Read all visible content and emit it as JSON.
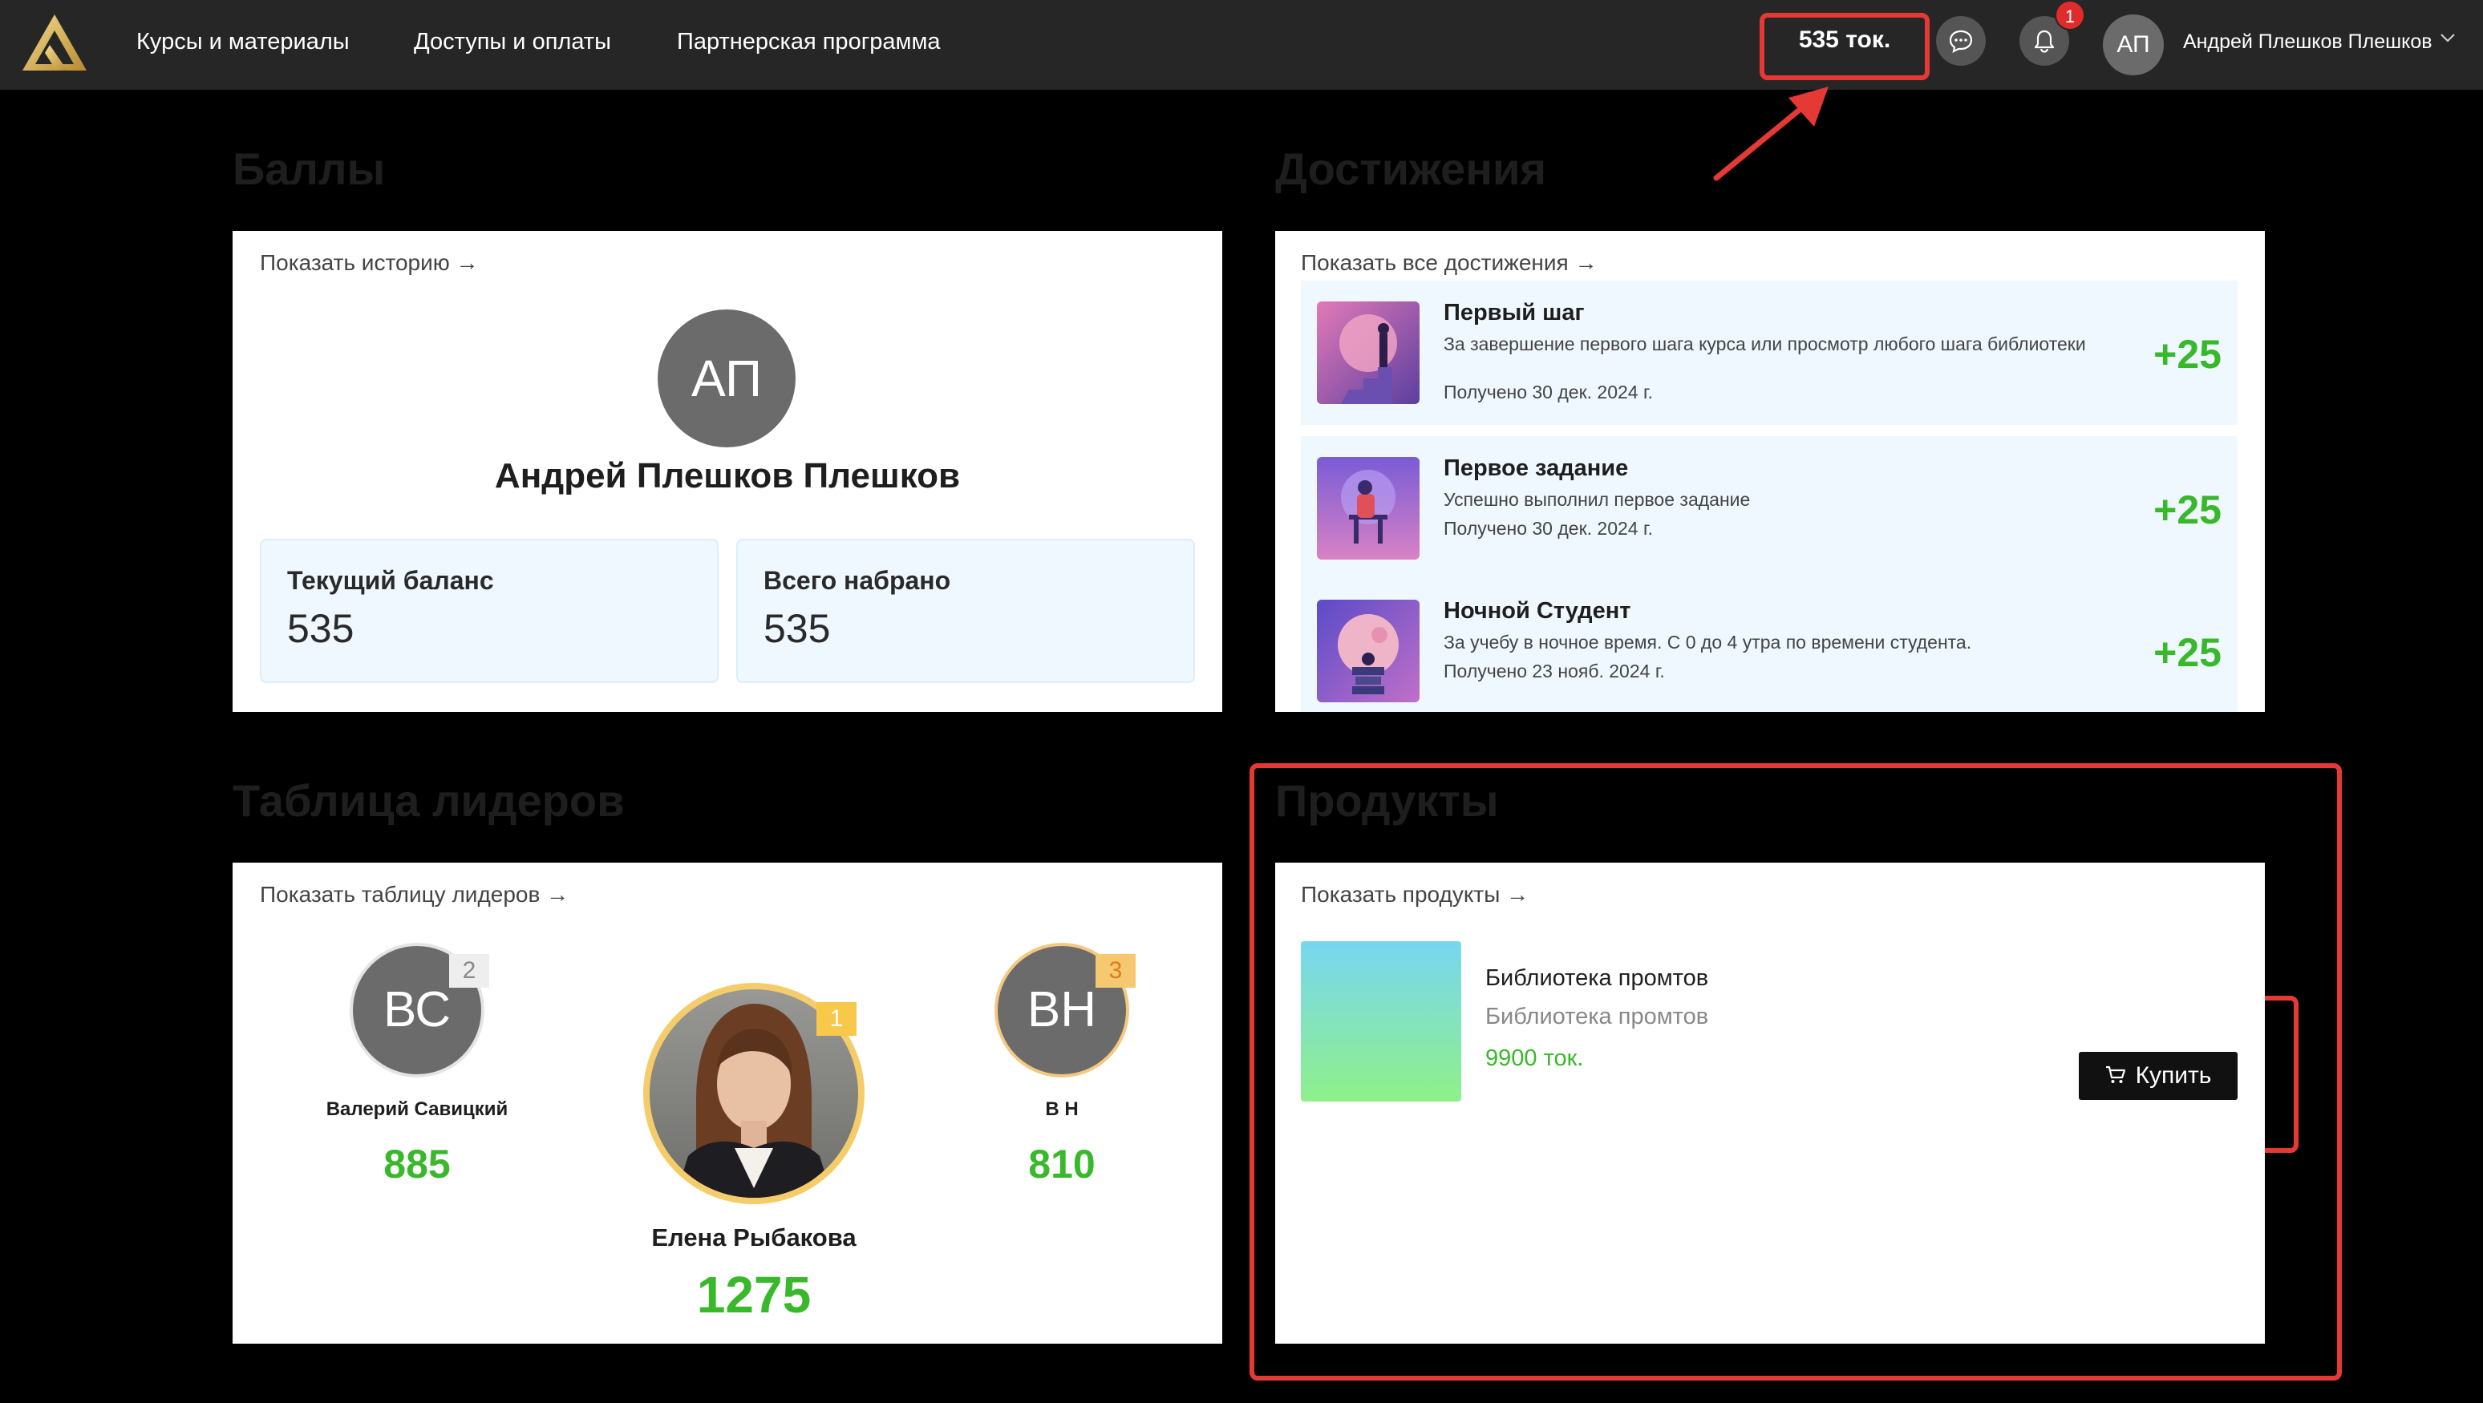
{
  "nav": {
    "items": [
      "Курсы и материалы",
      "Доступы и оплаты",
      "Партнерская программа"
    ],
    "balance": "535 ток.",
    "notification_count": "1",
    "avatar_initials": "АП",
    "user_name": "Андрей Плешков Плешков"
  },
  "points": {
    "title": "Баллы",
    "history_link": "Показать историю →",
    "avatar_initials": "АП",
    "full_name": "Андрей Плешков Плешков",
    "current_balance_label": "Текущий баланс",
    "current_balance_value": "535",
    "total_label": "Всего набрано",
    "total_value": "535"
  },
  "achievements": {
    "title": "Достижения",
    "all_link": "Показать все достижения →",
    "items": [
      {
        "title": "Первый шаг",
        "description": "За завершение первого шага курса или просмотр любого шага библиотеки",
        "date": "Получено 30 дек. 2024 г.",
        "points": "+25"
      },
      {
        "title": "Первое задание",
        "description": "Успешно выполнил первое задание",
        "date": "Получено 30 дек. 2024 г.",
        "points": "+25"
      },
      {
        "title": "Ночной Студент",
        "description": "За учебу в ночное время. С 0 до 4 утра по времени студента.",
        "date": "Получено 23 нояб. 2024 г.",
        "points": "+25"
      }
    ]
  },
  "leaderboard": {
    "title": "Таблица лидеров",
    "link": "Показать таблицу лидеров →",
    "leaders": [
      {
        "rank": "2",
        "initials": "ВС",
        "name": "Валерий Савицкий",
        "score": "885"
      },
      {
        "rank": "1",
        "initials": "",
        "name": "Елена Рыбакова",
        "score": "1275"
      },
      {
        "rank": "3",
        "initials": "ВН",
        "name": "В Н",
        "score": "810"
      }
    ]
  },
  "products": {
    "title": "Продукты",
    "link": "Показать продукты →",
    "items": [
      {
        "name": "Библиотека промтов",
        "subtitle": "Библиотека промтов",
        "price": "9900 ток.",
        "buy_label": "Купить"
      }
    ]
  },
  "colors": {
    "accent_green": "#38b82a",
    "annotation_red": "#e53935",
    "topbar": "#262626"
  }
}
